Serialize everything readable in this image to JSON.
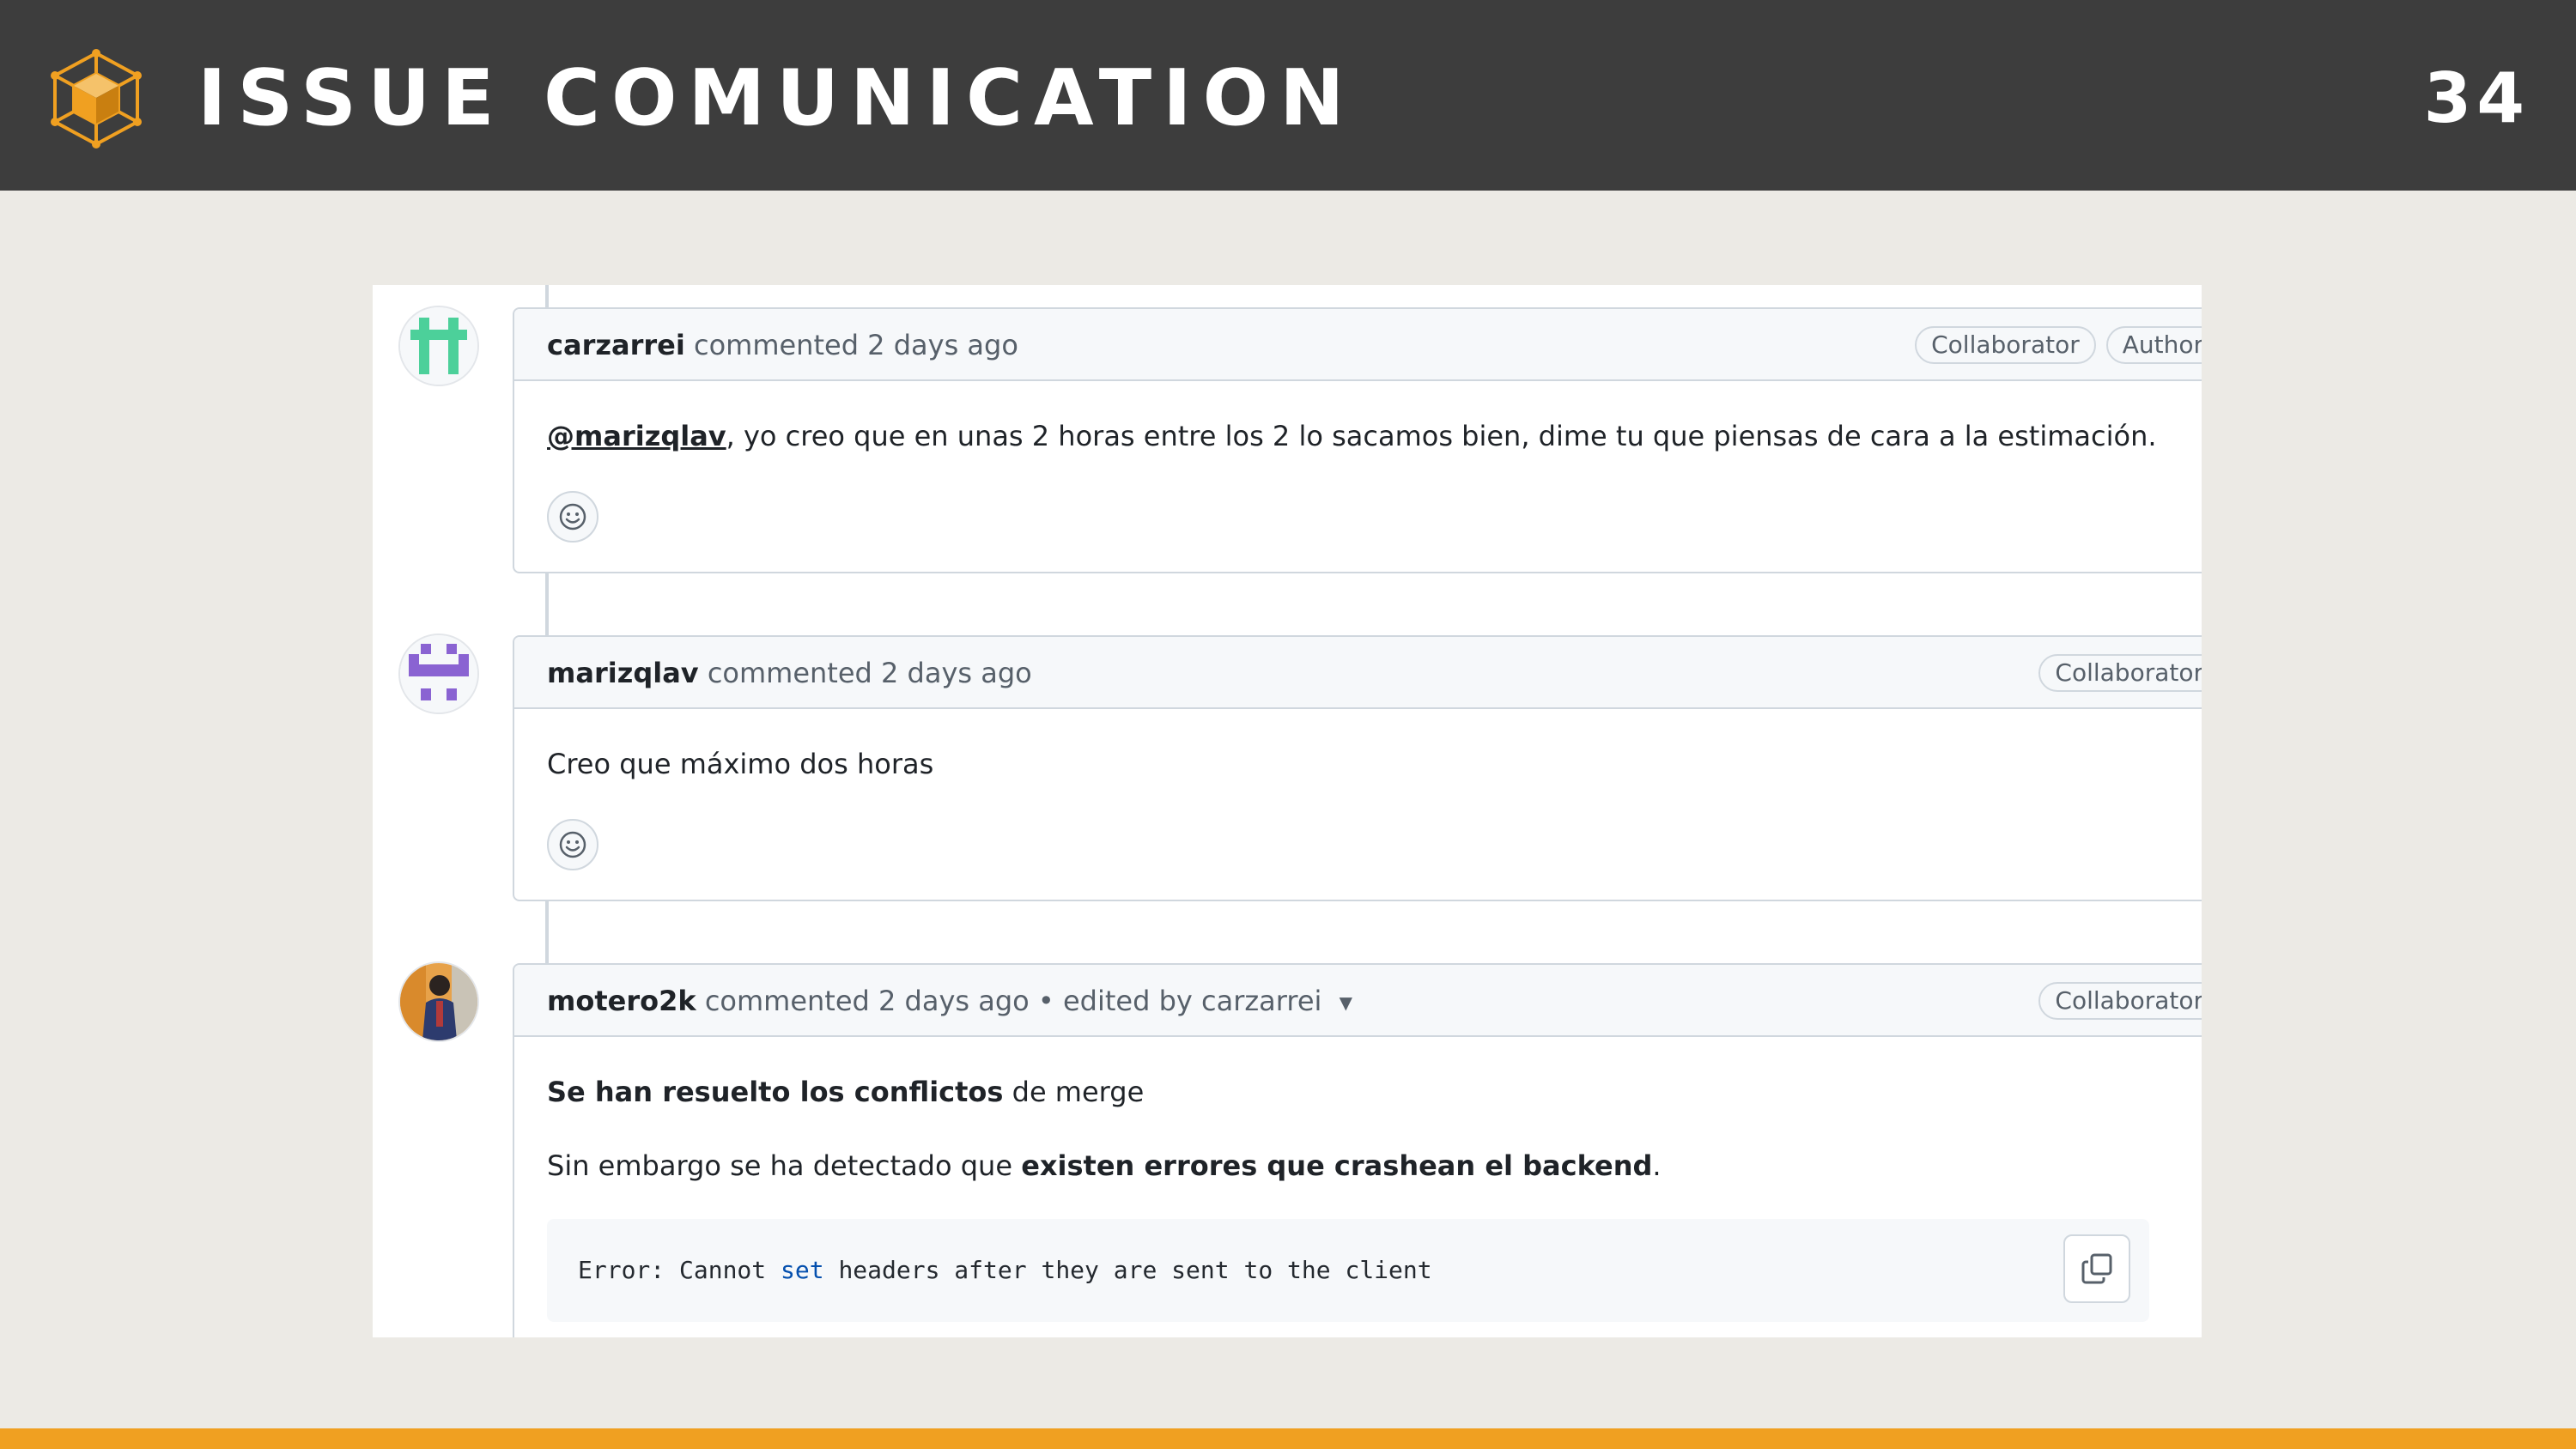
{
  "slide": {
    "title": "ISSUE COMUNICATION",
    "page_number": "34",
    "accent_color": "#f0a021",
    "header_color": "#3d3d3d",
    "logo_icon": "cube-network-icon"
  },
  "comments": [
    {
      "author": "carzarrei",
      "action": "commented",
      "time": "2 days ago",
      "edited": "",
      "badges": [
        "Collaborator",
        "Author"
      ],
      "body": {
        "mention": "@marizqlav",
        "text": ", yo creo que en unas 2 horas entre los 2 lo sacamos bien, dime tu que piensas de cara a la estimación."
      }
    },
    {
      "author": "marizqlav",
      "action": "commented",
      "time": "2 days ago",
      "edited": "",
      "badges": [
        "Collaborator"
      ],
      "body": {
        "text": "Creo que máximo dos horas"
      }
    },
    {
      "author": "motero2k",
      "action": "commented",
      "time": "2 days ago",
      "edited": "• edited by carzarrei",
      "badges": [
        "Collaborator"
      ],
      "body": {
        "p1_bold": "Se han resuelto los conflictos",
        "p1_rest": " de merge",
        "p2_start": "Sin embargo se ha detectado que ",
        "p2_bold": "existen errores que crashean el backend",
        "p2_end": ".",
        "code": {
          "before": "Error: Cannot ",
          "keyword": "set",
          "after": " headers after they are sent to the client"
        }
      }
    }
  ]
}
